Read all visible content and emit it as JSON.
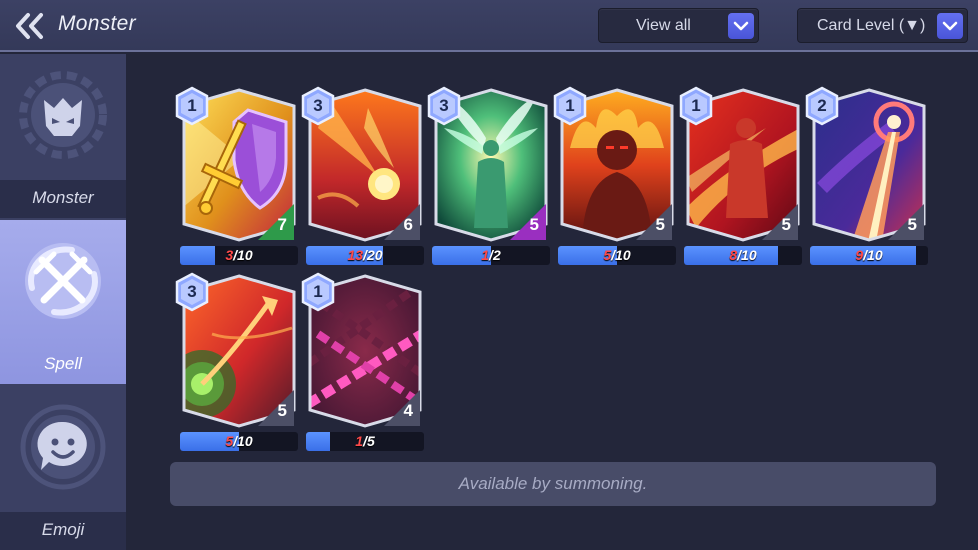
{
  "header": {
    "title": "Monster",
    "filter_label": "View all",
    "sort_label": "Card Level (▼)"
  },
  "sidebar": {
    "tabs": [
      {
        "label": "Monster",
        "icon": "monster-helmet-icon",
        "selected": false
      },
      {
        "label": "Spell",
        "icon": "crossed-swords-icon",
        "selected": true
      },
      {
        "label": "Emoji",
        "icon": "smiley-chat-icon",
        "selected": false
      }
    ]
  },
  "cards": [
    {
      "name": "holy-shield-sword",
      "level": "1",
      "cost": "7",
      "owned": 3,
      "required": 10,
      "cost_color": "#2e9a4a"
    },
    {
      "name": "meteor",
      "level": "3",
      "cost": "6",
      "owned": 13,
      "required": 20,
      "cost_color": "#4c4f66"
    },
    {
      "name": "angel-wings",
      "level": "3",
      "cost": "5",
      "owned": 1,
      "required": 2,
      "cost_color": "#9a2fc0"
    },
    {
      "name": "fire-lord",
      "level": "1",
      "cost": "5",
      "owned": 5,
      "required": 10,
      "cost_color": "#4c4f66"
    },
    {
      "name": "flame-warrior",
      "level": "1",
      "cost": "5",
      "owned": 8,
      "required": 10,
      "cost_color": "#4c4f66"
    },
    {
      "name": "sky-laser",
      "level": "2",
      "cost": "5",
      "owned": 9,
      "required": 10,
      "cost_color": "#4c4f66"
    },
    {
      "name": "poison-arrow",
      "level": "3",
      "cost": "5",
      "owned": 5,
      "required": 10,
      "cost_color": "#4c4f66"
    },
    {
      "name": "chains",
      "level": "1",
      "cost": "4",
      "owned": 1,
      "required": 5,
      "cost_color": "#4c4f66"
    }
  ],
  "notice": "Available by summoning."
}
